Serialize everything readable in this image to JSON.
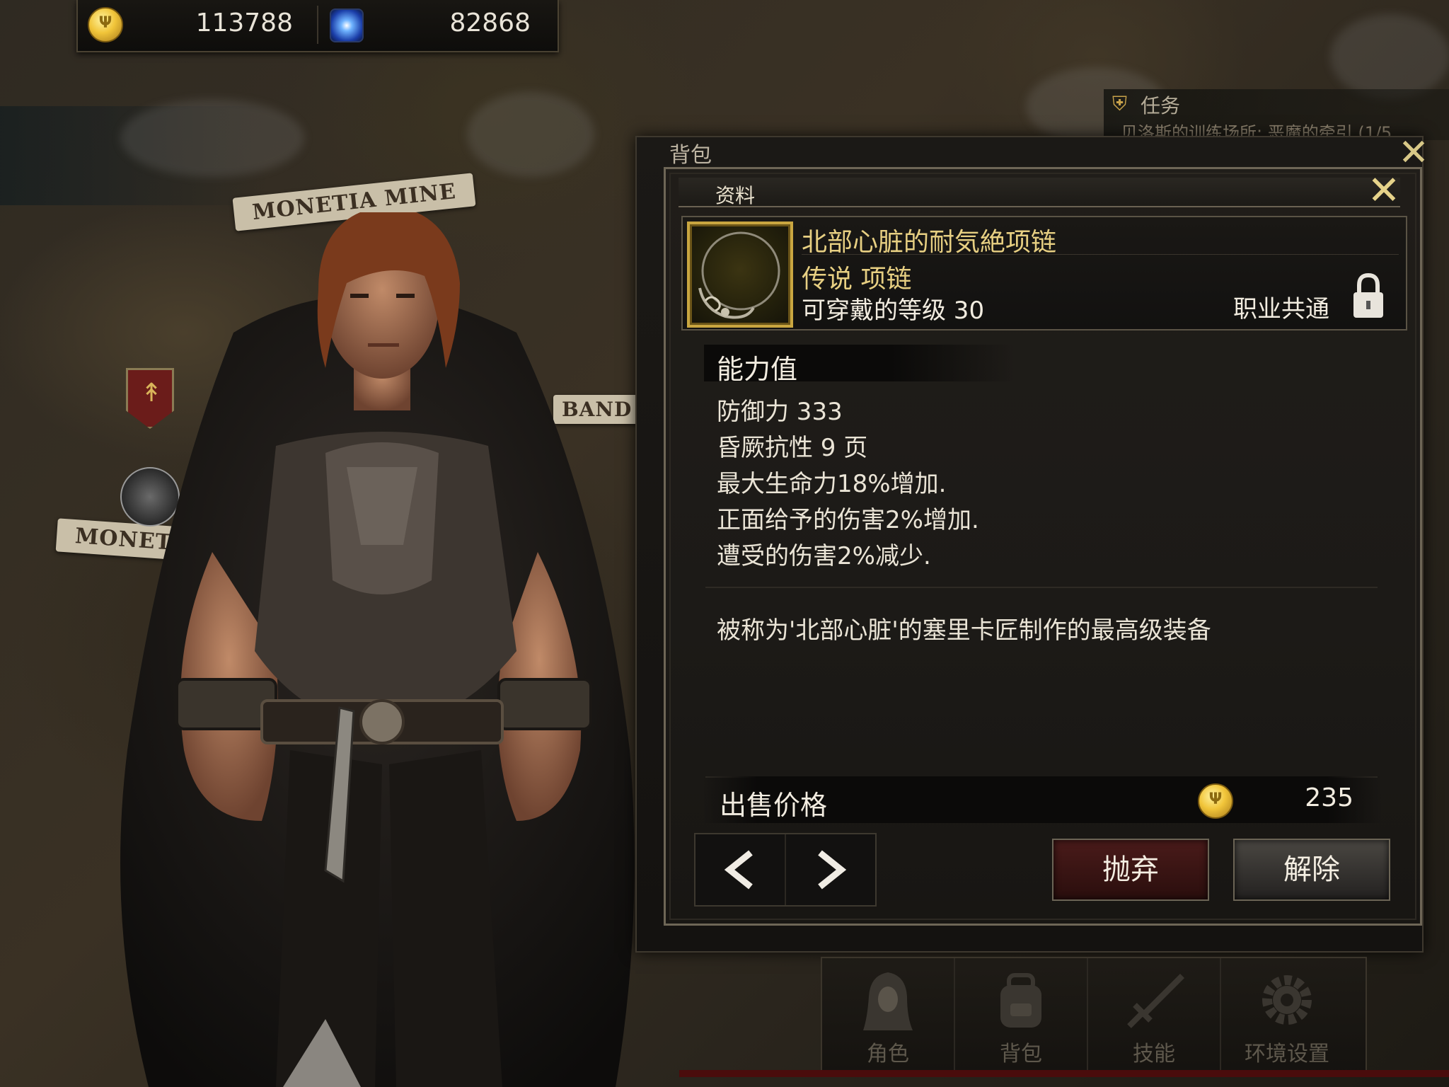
{
  "currency": {
    "gold": "113788",
    "gems": "82868",
    "gold_icon": "gold-coin-icon",
    "gem_icon": "blue-gem-icon"
  },
  "map": {
    "labels": [
      "MONETIA MINE",
      "MONETI",
      "BAND"
    ]
  },
  "quest": {
    "title": "任务",
    "text": "贝洛斯的训练场所: 恶魔的牵引 (1/5"
  },
  "inventory": {
    "title": "背包"
  },
  "detail": {
    "title": "资料",
    "item": {
      "name": "北部心脏的耐気絶项链",
      "grade": "传说 项链",
      "level": "可穿戴的等级 30",
      "class": "职业共通"
    },
    "stats_heading": "能力值",
    "stats": [
      "防御力 333",
      "昏厥抗性 9 页",
      "最大生命力18%增加.",
      "正面给予的伤害2%增加.",
      "遭受的伤害2%减少."
    ],
    "description": "被称为'北部心脏'的塞里卡匠制作的最高级装备",
    "price_label": "出售价格",
    "price": "235",
    "buttons": {
      "discard": "抛弃",
      "release": "解除"
    }
  },
  "bottom_nav": [
    "角色",
    "背包",
    "技能",
    "环境设置"
  ],
  "colors": {
    "gold_text": "#e7cf82",
    "discard_bg": "#4a1b1a",
    "panel_border": "#6e6656"
  }
}
